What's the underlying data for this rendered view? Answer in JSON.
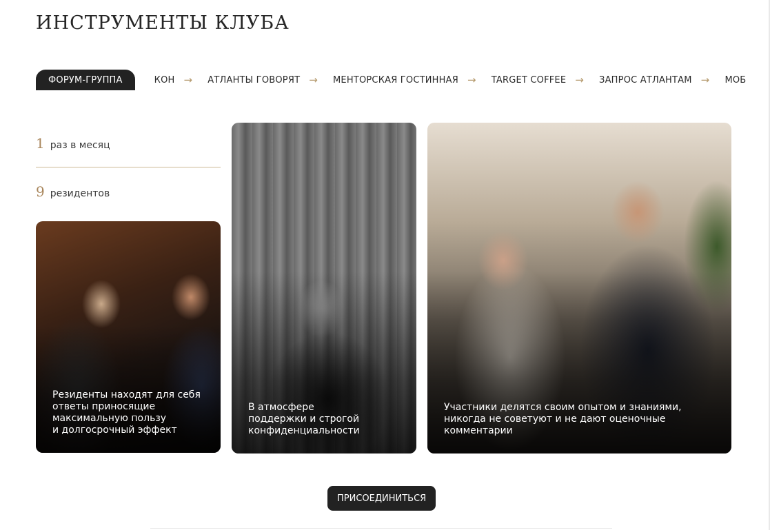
{
  "title": "ИНСТРУМЕНТЫ КЛУБА",
  "tabs": {
    "active": "ФОРУМ-ГРУППА",
    "items": [
      {
        "label": "КОН",
        "arrow": "→"
      },
      {
        "label": "АТЛАНТЫ ГОВОРЯТ",
        "arrow": "→"
      },
      {
        "label": "МЕНТОРСКАЯ ГОСТИННАЯ",
        "arrow": "→"
      },
      {
        "label": "TARGET COFFEE",
        "arrow": "→"
      },
      {
        "label": "ЗАПРОС АТЛАНТАМ",
        "arrow": "→"
      },
      {
        "label": "МОБ",
        "arrow": ""
      }
    ]
  },
  "stats": [
    {
      "num": "1",
      "text": "раз в месяц"
    },
    {
      "num": "9",
      "text": "резидентов"
    }
  ],
  "cards": [
    {
      "caption": "Резиденты находят для себя\nответы приносящие\nмаксимальную пользу\nи долгосрочный эффект"
    },
    {
      "caption": "В атмосфере\nподдержки и строгой\nконфиденциальности"
    },
    {
      "caption": "Участники делятся своим опытом и знаниями,\nникогда не советуют и не дают оценочные\nкомментарии"
    }
  ],
  "join_button": "ПРИСОЕДИНИТЬСЯ"
}
